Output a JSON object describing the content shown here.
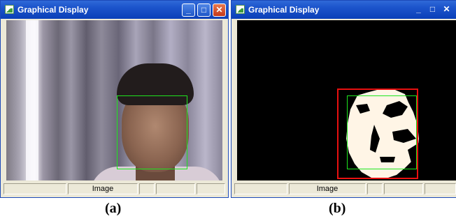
{
  "windows": [
    {
      "title": "Graphical Display",
      "status": "Image",
      "caption": "(a)"
    },
    {
      "title": "Graphical Display",
      "status": "Image",
      "caption": "(b)"
    }
  ],
  "titlebar_buttons": {
    "minimize": "_",
    "maximize": "□",
    "close": "✕"
  },
  "colors": {
    "face_box": "#1ee61e",
    "skin_region_box": "#e81010",
    "skin_mask": "#fff5e6",
    "background_mask": "#000000"
  },
  "icons": [
    "app-icon",
    "minimize-icon",
    "maximize-icon",
    "close-icon"
  ]
}
